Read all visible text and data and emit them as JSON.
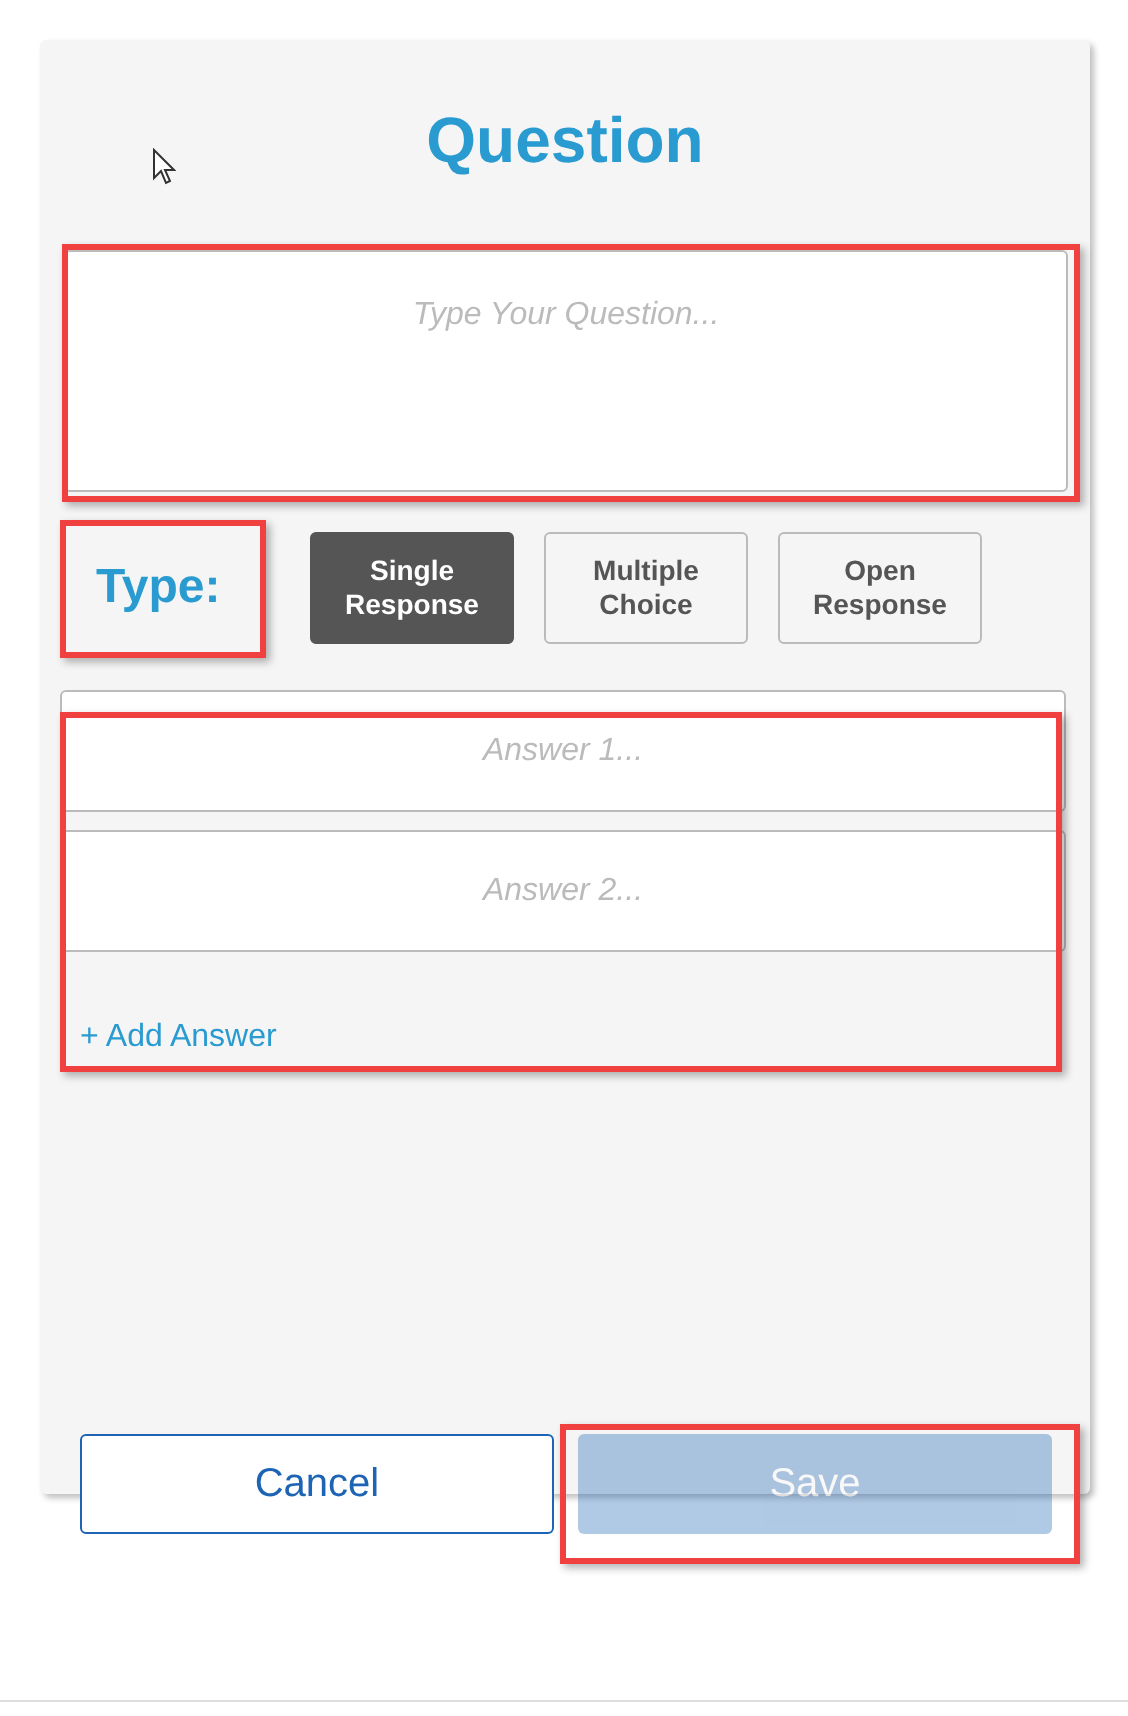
{
  "title": "Question",
  "question": {
    "placeholder": "Type Your Question..."
  },
  "type_label": "Type:",
  "types": [
    {
      "label": "Single Response",
      "selected": true
    },
    {
      "label": "Multiple Choice",
      "selected": false
    },
    {
      "label": "Open Response",
      "selected": false
    }
  ],
  "answers": [
    {
      "placeholder": "Answer 1..."
    },
    {
      "placeholder": "Answer 2..."
    }
  ],
  "add_answer": "+ Add Answer",
  "buttons": [
    {
      "label": "Cancel",
      "kind": "secondary",
      "disabled": false
    },
    {
      "label": "Save",
      "kind": "primary",
      "disabled": true
    }
  ]
}
